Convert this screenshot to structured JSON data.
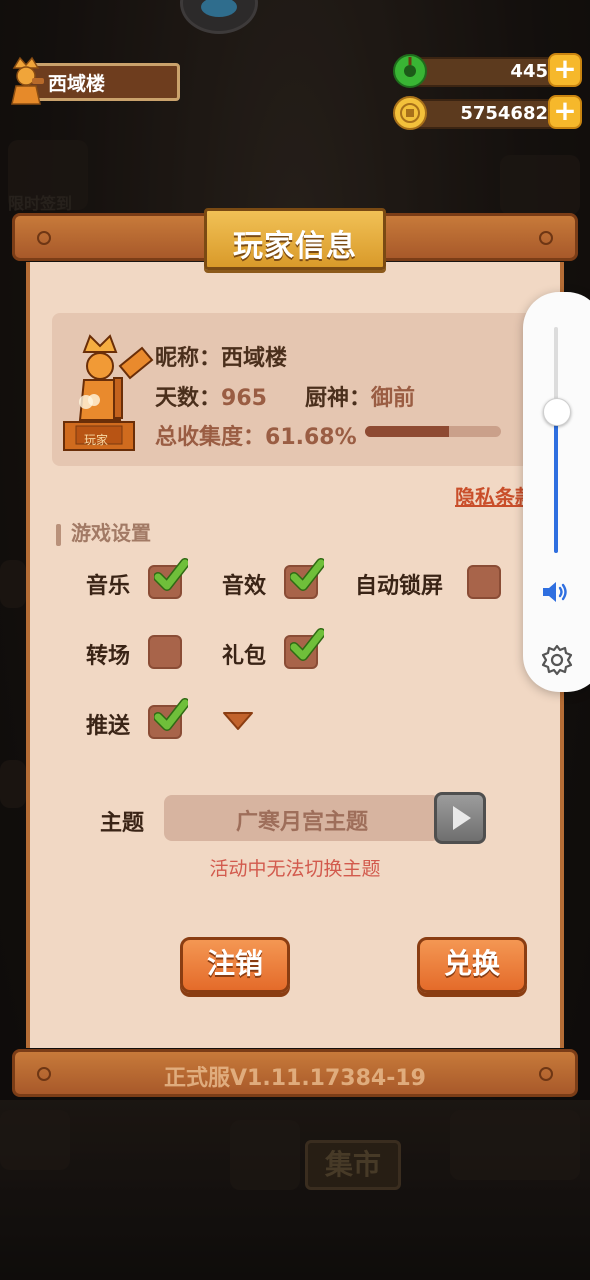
{
  "header": {
    "player_name": "西域楼",
    "jade": {
      "value": "445",
      "icon": "jade-coin-icon"
    },
    "gold": {
      "value": "5754682",
      "icon": "gold-coin-icon"
    }
  },
  "background": {
    "left_label": "限时签到",
    "market_sign": "集市"
  },
  "modal": {
    "title": "玩家信息",
    "nickname_label": "昵称：",
    "nickname": "西域楼",
    "days_label": "天数：",
    "days": "965",
    "chef_label": "厨神：",
    "chef": "御前",
    "collection_label": "总收集度：",
    "collection": "61.68%",
    "collection_fraction": 0.6168,
    "statue_label": "玩家",
    "privacy_link": "隐私条款",
    "settings_title": "游戏设置",
    "settings": {
      "music": {
        "label": "音乐",
        "checked": true
      },
      "sfx": {
        "label": "音效",
        "checked": true
      },
      "autolock": {
        "label": "自动锁屏",
        "checked": false
      },
      "transition": {
        "label": "转场",
        "checked": false
      },
      "gift": {
        "label": "礼包",
        "checked": true
      },
      "push": {
        "label": "推送",
        "checked": true
      }
    },
    "theme_label": "主题",
    "theme_value": "广寒月宫主题",
    "theme_hint": "活动中无法切换主题",
    "logout_button": "注销",
    "redeem_button": "兑换",
    "version": "正式服V1.11.17384-19"
  },
  "volume": {
    "level_fraction": 0.63
  },
  "colors": {
    "accent": "#e46b2a",
    "check_green": "#6fbf3a",
    "slider_blue": "#2f6fe0"
  }
}
